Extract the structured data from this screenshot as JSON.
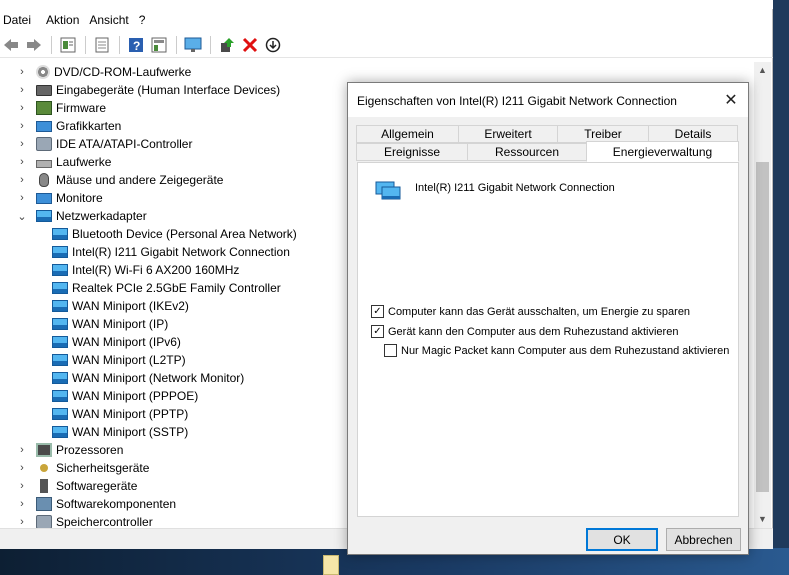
{
  "devmgr": {
    "menu": [
      "Datei",
      "Aktion",
      "Ansicht",
      "?"
    ],
    "toolbar_icons": [
      "back-icon",
      "forward-icon",
      "properties-view-icon",
      "list-view-icon",
      "help-icon",
      "action-pane-icon",
      "monitor-icon",
      "update-driver-icon",
      "uninstall-icon",
      "scan-icon"
    ],
    "tree": [
      {
        "label": "DVD/CD-ROM-Laufwerke",
        "level": 0,
        "expanded": false,
        "icon": "disc-icon"
      },
      {
        "label": "Eingabegeräte (Human Interface Devices)",
        "level": 0,
        "expanded": false,
        "icon": "keyboard-icon"
      },
      {
        "label": "Firmware",
        "level": 0,
        "expanded": false,
        "icon": "chip-icon"
      },
      {
        "label": "Grafikkarten",
        "level": 0,
        "expanded": false,
        "icon": "display-adapter-icon"
      },
      {
        "label": "IDE ATA/ATAPI-Controller",
        "level": 0,
        "expanded": false,
        "icon": "controller-icon"
      },
      {
        "label": "Laufwerke",
        "level": 0,
        "expanded": false,
        "icon": "drive-icon"
      },
      {
        "label": "Mäuse und andere Zeigegeräte",
        "level": 0,
        "expanded": false,
        "icon": "mouse-icon"
      },
      {
        "label": "Monitore",
        "level": 0,
        "expanded": false,
        "icon": "monitor-icon"
      },
      {
        "label": "Netzwerkadapter",
        "level": 0,
        "expanded": true,
        "icon": "network-icon"
      },
      {
        "label": "Bluetooth Device (Personal Area Network)",
        "level": 1,
        "icon": "network-adapter-icon"
      },
      {
        "label": "Intel(R) I211 Gigabit Network Connection",
        "level": 1,
        "icon": "network-adapter-icon"
      },
      {
        "label": "Intel(R) Wi-Fi 6 AX200 160MHz",
        "level": 1,
        "icon": "network-adapter-icon"
      },
      {
        "label": "Realtek PCIe 2.5GbE Family Controller",
        "level": 1,
        "icon": "network-adapter-icon"
      },
      {
        "label": "WAN Miniport (IKEv2)",
        "level": 1,
        "icon": "network-adapter-icon"
      },
      {
        "label": "WAN Miniport (IP)",
        "level": 1,
        "icon": "network-adapter-icon"
      },
      {
        "label": "WAN Miniport (IPv6)",
        "level": 1,
        "icon": "network-adapter-icon"
      },
      {
        "label": "WAN Miniport (L2TP)",
        "level": 1,
        "icon": "network-adapter-icon"
      },
      {
        "label": "WAN Miniport (Network Monitor)",
        "level": 1,
        "icon": "network-adapter-icon"
      },
      {
        "label": "WAN Miniport (PPPOE)",
        "level": 1,
        "icon": "network-adapter-icon"
      },
      {
        "label": "WAN Miniport (PPTP)",
        "level": 1,
        "icon": "network-adapter-icon"
      },
      {
        "label": "WAN Miniport (SSTP)",
        "level": 1,
        "icon": "network-adapter-icon"
      },
      {
        "label": "Prozessoren",
        "level": 0,
        "expanded": false,
        "icon": "processor-icon"
      },
      {
        "label": "Sicherheitsgeräte",
        "level": 0,
        "expanded": false,
        "icon": "security-key-icon"
      },
      {
        "label": "Softwaregeräte",
        "level": 0,
        "expanded": false,
        "icon": "software-device-icon"
      },
      {
        "label": "Softwarekomponenten",
        "level": 0,
        "expanded": false,
        "icon": "software-component-icon"
      },
      {
        "label": "Speichercontroller",
        "level": 0,
        "expanded": false,
        "icon": "storage-controller-icon"
      }
    ]
  },
  "dialog": {
    "title": "Eigenschaften von Intel(R) I211 Gigabit Network Connection",
    "tabs_row1": [
      "Allgemein",
      "Erweitert",
      "Treiber",
      "Details"
    ],
    "tabs_row2": [
      "Ereignisse",
      "Ressourcen",
      "Energieverwaltung"
    ],
    "active_tab": "Energieverwaltung",
    "device_name": "Intel(R) I211 Gigabit Network Connection",
    "options": [
      {
        "label": "Computer kann das Gerät ausschalten, um Energie zu sparen",
        "checked": true
      },
      {
        "label": "Gerät kann den Computer aus dem Ruhezustand aktivieren",
        "checked": true
      },
      {
        "label": "Nur Magic Packet kann Computer aus dem Ruhezustand aktivieren",
        "checked": false
      }
    ],
    "ok_label": "OK",
    "cancel_label": "Abbrechen"
  }
}
